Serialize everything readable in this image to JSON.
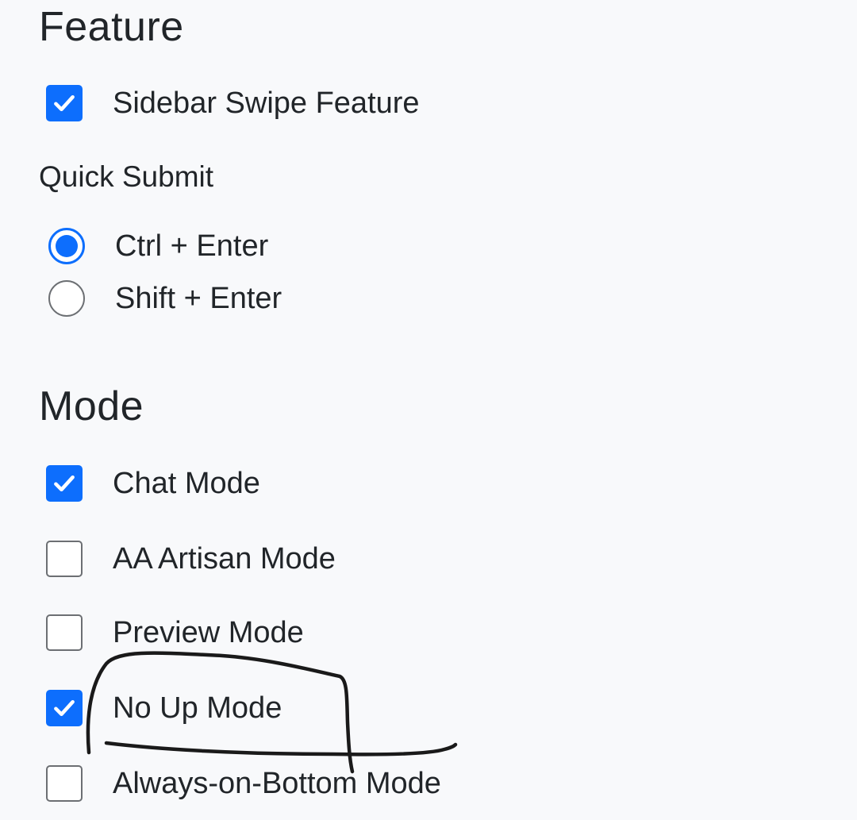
{
  "feature": {
    "heading": "Feature",
    "sidebar_swipe": {
      "label": "Sidebar Swipe Feature",
      "checked": true
    },
    "quick_submit": {
      "label": "Quick Submit",
      "options": [
        {
          "label": "Ctrl + Enter",
          "selected": true
        },
        {
          "label": "Shift + Enter",
          "selected": false
        }
      ]
    }
  },
  "mode": {
    "heading": "Mode",
    "items": [
      {
        "label": "Chat Mode",
        "checked": true
      },
      {
        "label": "AA Artisan Mode",
        "checked": false
      },
      {
        "label": "Preview Mode",
        "checked": false
      },
      {
        "label": "No Up Mode",
        "checked": true
      },
      {
        "label": "Always-on-Bottom Mode",
        "checked": false
      }
    ]
  },
  "colors": {
    "accent": "#0d6efd",
    "background": "#f8f9fb",
    "text": "#212529",
    "annotation_ink": "#1a1a1a"
  }
}
